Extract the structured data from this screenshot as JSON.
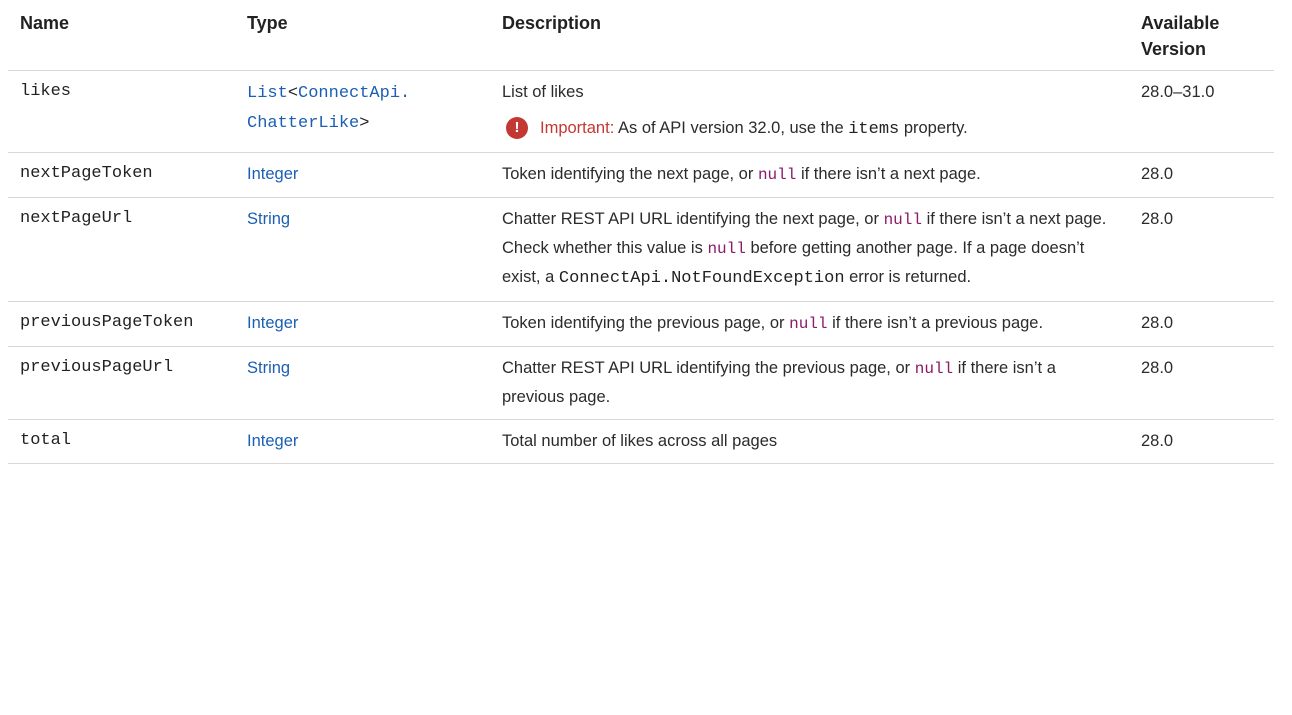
{
  "headers": {
    "name": "Name",
    "type": "Type",
    "description": "Description",
    "version": "Available Version"
  },
  "rows": [
    {
      "name": "likes",
      "type_parts": [
        "List",
        "<",
        "ConnectApi.",
        "ChatterLike",
        ">"
      ],
      "description": "List of likes",
      "important": {
        "label": "Important:",
        "text_before": "As of API version 32.0, use the",
        "code": "items",
        "text_after": "property."
      },
      "version": "28.0–31.0"
    },
    {
      "name": "nextPageToken",
      "type": "Integer",
      "desc_before": "Token identifying the next page, or",
      "desc_code": "null",
      "desc_after": "if there isn’t a next page.",
      "version": "28.0"
    },
    {
      "name": "nextPageUrl",
      "type": "String",
      "desc_1": "Chatter REST API URL identifying the next page, or",
      "desc_code1": "null",
      "desc_2": "if there isn’t a next page. Check whether this value is",
      "desc_code2": "null",
      "desc_3": "before getting another page. If a page doesn’t exist, a",
      "desc_code3": "ConnectApi.NotFoundException",
      "desc_4": "error is returned.",
      "version": "28.0"
    },
    {
      "name": "previousPageToken",
      "type": "Integer",
      "desc_before": "Token identifying the previous page, or",
      "desc_code": "null",
      "desc_after": "if there isn’t a previous page.",
      "version": "28.0"
    },
    {
      "name": "previousPageUrl",
      "type": "String",
      "desc_before": "Chatter REST API URL identifying the previous page, or",
      "desc_code": "null",
      "desc_after": "if there isn’t a previous page.",
      "version": "28.0"
    },
    {
      "name": "total",
      "type": "Integer",
      "description": "Total number of likes across all pages",
      "version": "28.0"
    }
  ],
  "colors": {
    "link": "#1a5fb4",
    "code_null": "#8b1a6b",
    "important": "#c23934"
  },
  "icons": {
    "important": "exclamation-circle-icon",
    "important_glyph": "!"
  }
}
